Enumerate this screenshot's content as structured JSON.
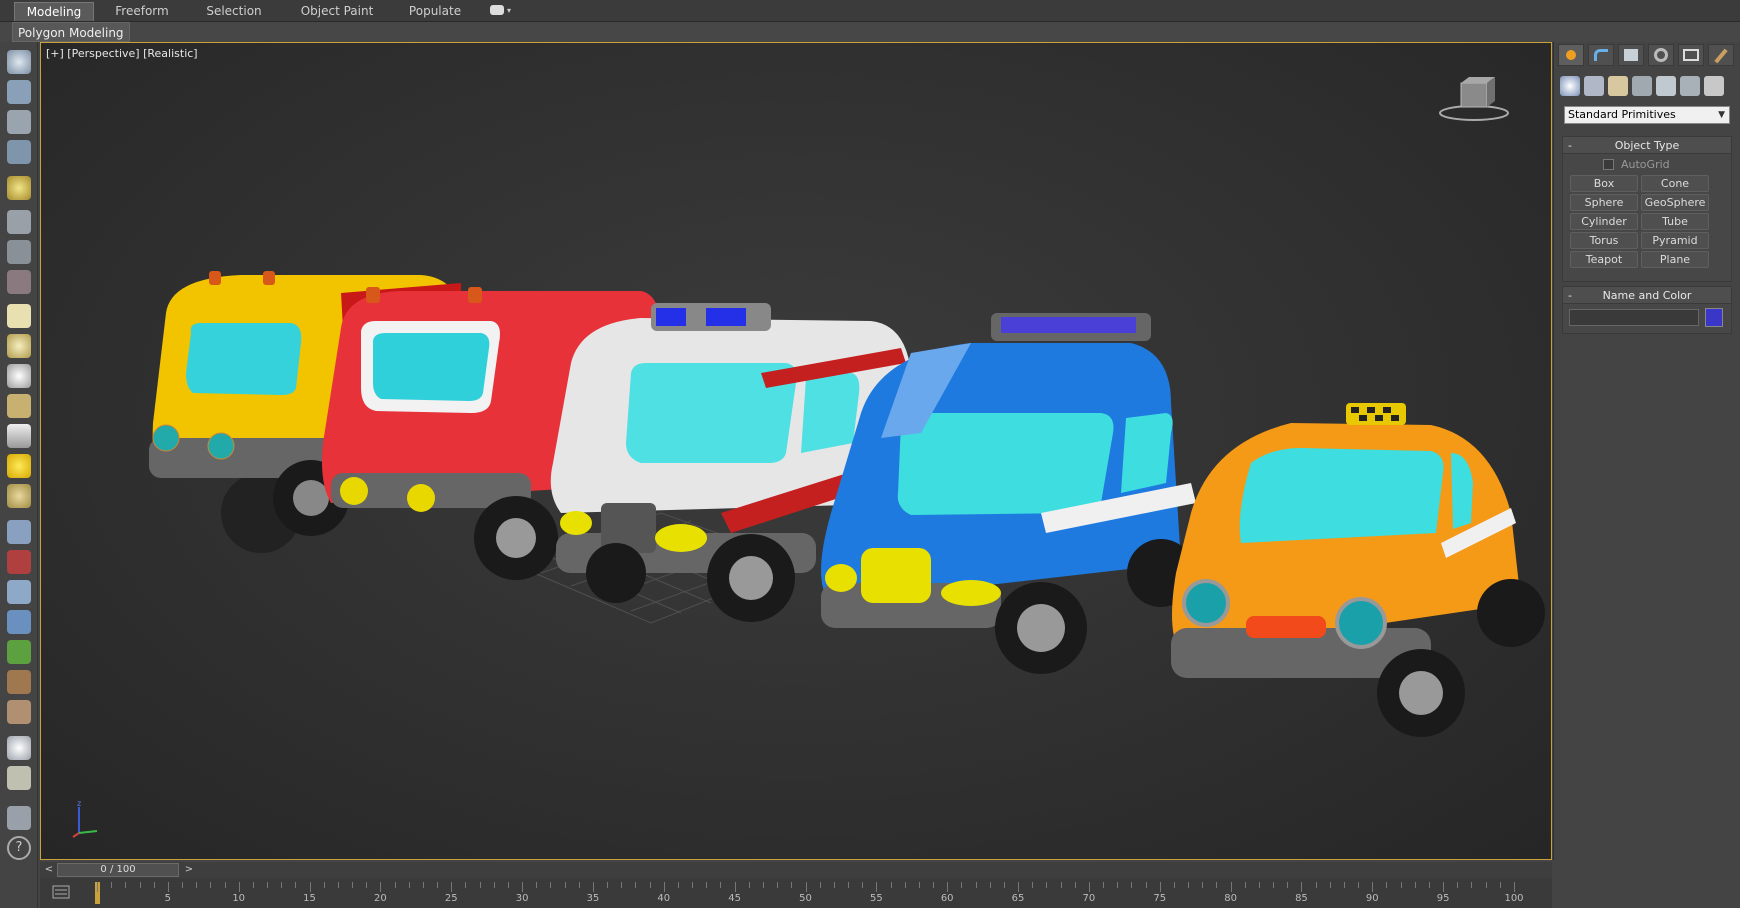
{
  "ribbon": {
    "tabs": [
      "Modeling",
      "Freeform",
      "Selection",
      "Object Paint",
      "Populate"
    ],
    "active_tab": "Modeling",
    "subtab": "Polygon Modeling"
  },
  "viewport": {
    "label": "[+] [Perspective] [Realistic]"
  },
  "command_panel": {
    "dropdown_value": "Standard Primitives",
    "object_type": {
      "title": "Object Type",
      "autogrid_label": "AutoGrid",
      "buttons": [
        "Box",
        "Cone",
        "Sphere",
        "GeoSphere",
        "Cylinder",
        "Tube",
        "Torus",
        "Pyramid",
        "Teapot",
        "Plane"
      ]
    },
    "name_and_color": {
      "title": "Name and Color",
      "name_value": "",
      "color": "#3a36c8"
    }
  },
  "timeline": {
    "frame_display": "0 / 100",
    "prev": "<",
    "next": ">",
    "ticks": [
      "5",
      "10",
      "15",
      "20",
      "25",
      "30",
      "35",
      "40",
      "45",
      "50",
      "55",
      "60",
      "65",
      "70",
      "75",
      "80",
      "85",
      "90",
      "95",
      "100"
    ]
  },
  "colors": {
    "viewport_border": "#c9a23c",
    "panel_bg": "#444444"
  }
}
